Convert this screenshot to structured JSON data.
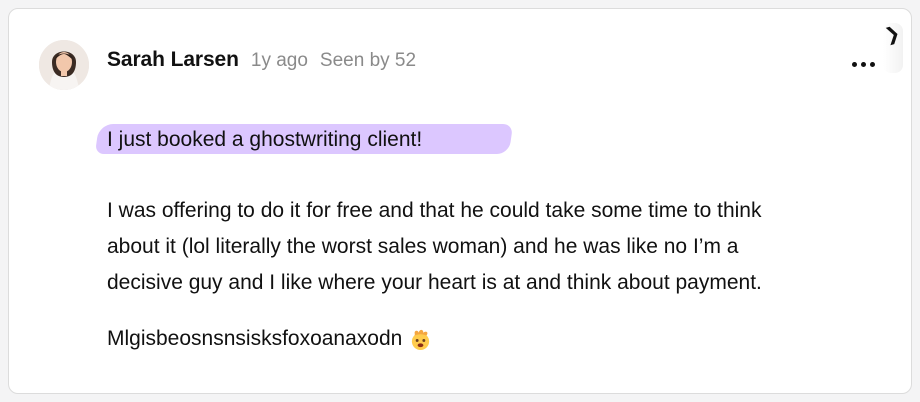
{
  "post": {
    "author": "Sarah Larsen",
    "time": "1y ago",
    "seen": "Seen by 52",
    "highlight": "I just booked a ghostwriting client!",
    "body_lines": [
      "I was offering to do it for free and that he could take some time to think",
      "about it (lol literally the worst sales woman) and he was like no I’m a",
      "decisive guy and I like where your heart is at and think about payment."
    ],
    "last_line": "Mlgisbeosnsnsisksfoxoanaxodn"
  },
  "icons": {
    "more": "more-horizontal-icon",
    "emoji": "exploding-head-icon",
    "corner": "corner-tab-icon"
  },
  "colors": {
    "highlight": "#dcc7ff",
    "text": "#111111",
    "muted": "#8a8a8a"
  }
}
